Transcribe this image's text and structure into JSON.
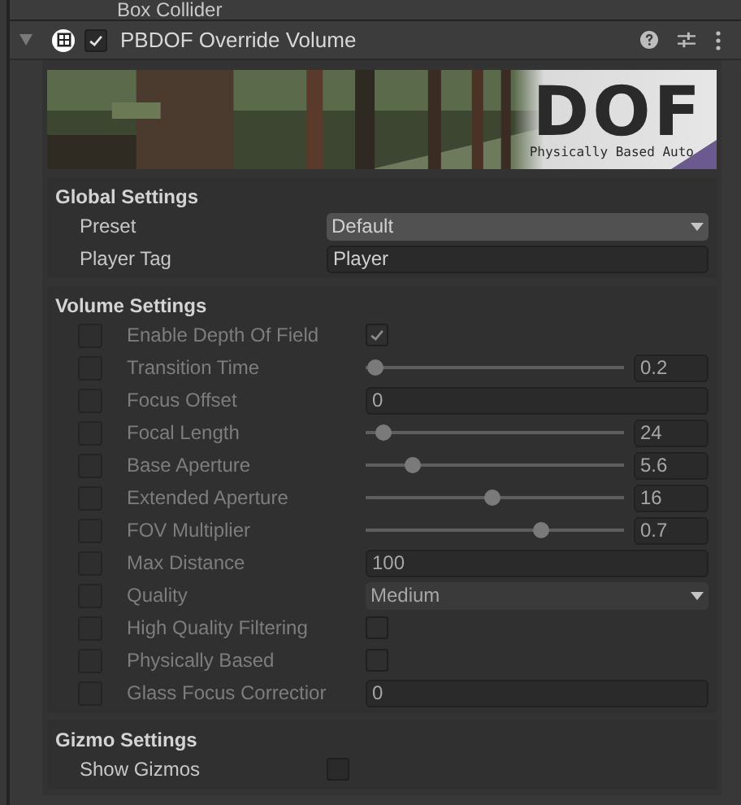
{
  "previous_component": {
    "title": "Box Collider"
  },
  "component": {
    "title": "PBDOF Override Volume",
    "enabled": true,
    "expanded": true
  },
  "banner": {
    "kind": "picture",
    "logo_title": "DOF",
    "logo_subtitle": "Physically Based Auto"
  },
  "sections": [
    {
      "title": "Global Settings",
      "rows": [
        {
          "kind": "dropdown",
          "label": "Preset",
          "value": "Default"
        },
        {
          "kind": "field",
          "label": "Player Tag",
          "value": "Player"
        }
      ]
    },
    {
      "title": "Volume Settings",
      "rows": [
        {
          "kind": "toggle",
          "override": false,
          "label": "Enable Depth Of Field",
          "checked": true
        },
        {
          "kind": "slider",
          "override": false,
          "label": "Transition Time",
          "level": 0.04,
          "value": "0.2"
        },
        {
          "kind": "field",
          "override": false,
          "label": "Focus Offset",
          "value": "0"
        },
        {
          "kind": "slider",
          "override": false,
          "label": "Focal Length",
          "level": 0.07,
          "value": "24"
        },
        {
          "kind": "slider",
          "override": false,
          "label": "Base Aperture",
          "level": 0.18,
          "value": "5.6"
        },
        {
          "kind": "slider",
          "override": false,
          "label": "Extended Aperture",
          "level": 0.49,
          "value": "16"
        },
        {
          "kind": "slider",
          "override": false,
          "label": "FOV Multiplier",
          "level": 0.68,
          "value": "0.7"
        },
        {
          "kind": "field",
          "override": false,
          "label": "Max Distance",
          "value": "100"
        },
        {
          "kind": "dropdown",
          "override": false,
          "label": "Quality",
          "value": "Medium"
        },
        {
          "kind": "toggle",
          "override": false,
          "label": "High Quality Filtering",
          "checked": false
        },
        {
          "kind": "toggle",
          "override": false,
          "label": "Physically Based",
          "checked": false
        },
        {
          "kind": "field",
          "override": false,
          "label": "Glass Focus Correctior",
          "value": "0"
        }
      ]
    },
    {
      "title": "Gizmo Settings",
      "rows": [
        {
          "kind": "toggle",
          "label": "Show Gizmos",
          "checked": false
        }
      ]
    }
  ]
}
